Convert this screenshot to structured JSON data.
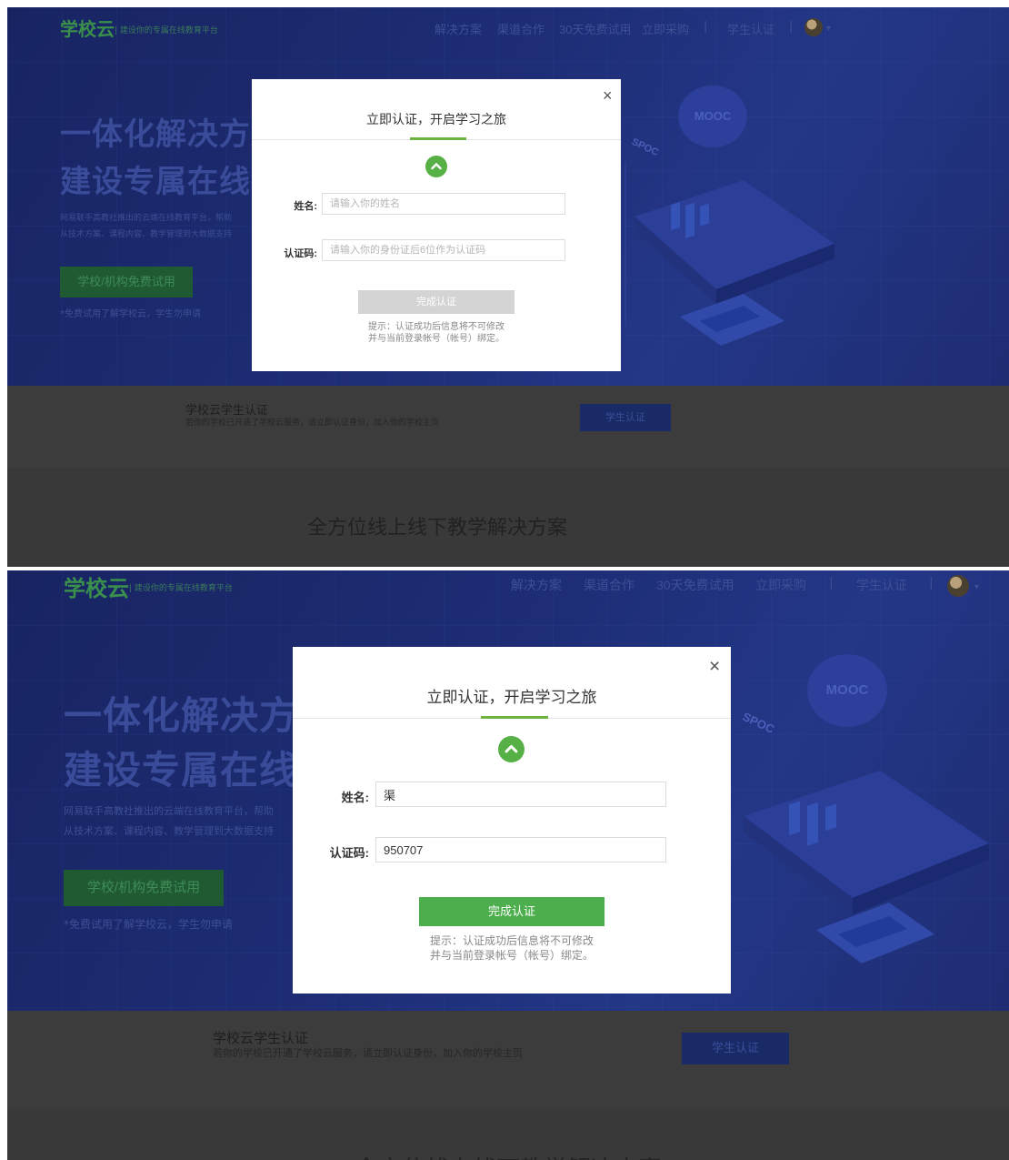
{
  "site": {
    "logo": "学校云",
    "logo_sub": "| 建设你的专属在线教育平台",
    "nav": [
      "解决方案",
      "渠道合作",
      "30天免费试用",
      "立即采购",
      "|",
      "学生认证",
      "|"
    ]
  },
  "hero": {
    "headline_1": "一体化解决方案",
    "headline_2": "建设专属在线教育平台",
    "desc_1": "网易联手高教社推出的云端在线教育平台，帮助",
    "desc_2": "从技术方案、课程内容、教学管理到大数据支持",
    "trial_button": "学校/机构免费试用",
    "trial_note": "*免费试用了解学校云，学生勿申请",
    "cloud_label": "MOOC",
    "spoc_label": "SPOC"
  },
  "student_strip": {
    "title": "学校云学生认证",
    "desc": "若你的学校已开通了学校云服务，请立即认证身份，加入你的学校主页",
    "button": "学生认证"
  },
  "section_title": "全方位线上线下教学解决方案",
  "modal": {
    "title": "立即认证，开启学习之旅",
    "close": "×",
    "name_label": "姓名:",
    "code_label": "认证码:",
    "name_placeholder": "请输入你的姓名",
    "code_placeholder": "请输入你的身份证后6位作为认证码",
    "submit": "完成认证",
    "tip_1": "提示：认证成功后信息将不可修改",
    "tip_2": "并与当前登录帐号（帐号）绑定。"
  },
  "screenshots": [
    {
      "state": "empty",
      "name_value": "",
      "code_value": ""
    },
    {
      "state": "filled",
      "name_value": "渠",
      "code_value": "950707"
    }
  ],
  "colors": {
    "hero_bg": "#1f2c6e",
    "accent_green": "#6cb33f",
    "submit_enabled": "#4cae4c",
    "submit_disabled": "#d4d4d4"
  }
}
